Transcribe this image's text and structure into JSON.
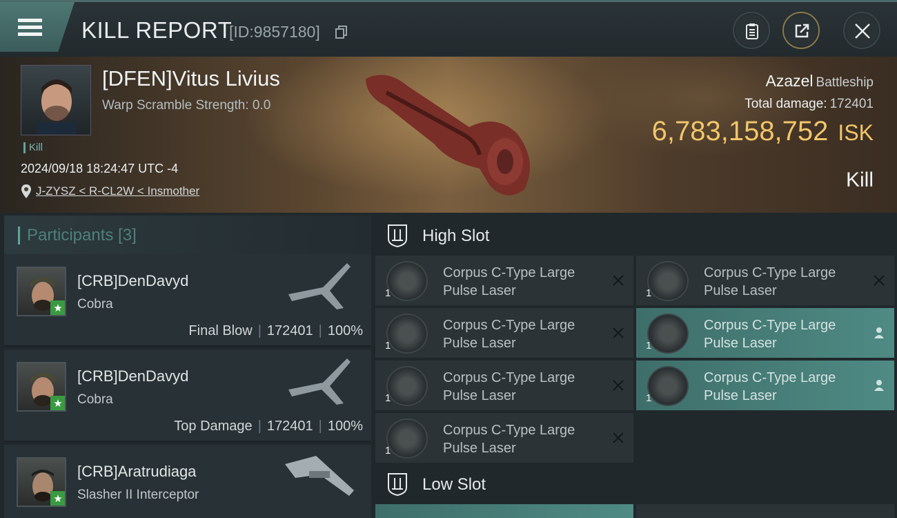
{
  "header": {
    "title": "KILL REPORT",
    "report_id": "[ID:9857180]",
    "icons": {
      "menu": "menu-icon",
      "copy": "copy-icon",
      "clipboard": "clipboard-icon",
      "share": "share-icon",
      "close": "close-icon"
    }
  },
  "victim": {
    "name": "[DFEN]Vitus Livius",
    "warp_scramble": "Warp Scramble Strength: 0.0",
    "kill_tag": "Kill",
    "timestamp": "2024/09/18 18:24:47 UTC -4",
    "location": "J-ZYSZ < R-CL2W < Insmother",
    "ship_name": "Azazel",
    "ship_class": "Battleship",
    "total_damage_label": "Total damage:",
    "total_damage": "172401",
    "isk_value": "6,783,158,752",
    "isk_unit": "ISK",
    "result": "Kill"
  },
  "participants": {
    "title": "Participants [3]",
    "rows": [
      {
        "name": "[CRB]DenDavyd",
        "ship": "Cobra",
        "role": "Final Blow",
        "damage": "172401",
        "percent": "100%"
      },
      {
        "name": "[CRB]DenDavyd",
        "ship": "Cobra",
        "role": "Top Damage",
        "damage": "172401",
        "percent": "100%"
      },
      {
        "name": "[CRB]Aratrudiaga",
        "ship": "Slasher II Interceptor",
        "role": "",
        "damage": "",
        "percent": ""
      }
    ]
  },
  "fitting": {
    "high_slot_title": "High Slot",
    "low_slot_title": "Low Slot",
    "high_modules": [
      {
        "name": "Corpus C-Type Large Pulse Laser",
        "qty": "1",
        "state": "destroyed"
      },
      {
        "name": "Corpus C-Type Large Pulse Laser",
        "qty": "1",
        "state": "destroyed"
      },
      {
        "name": "Corpus C-Type Large Pulse Laser",
        "qty": "1",
        "state": "destroyed"
      },
      {
        "name": "Corpus C-Type Large Pulse Laser",
        "qty": "1",
        "state": "dropped"
      },
      {
        "name": "Corpus C-Type Large Pulse Laser",
        "qty": "1",
        "state": "dropped"
      },
      {
        "name": "Corpus C-Type Large Pulse Laser",
        "qty": "1",
        "state": "destroyed"
      },
      {
        "name": "Corpus C-Type Large Pulse Laser",
        "qty": "1",
        "state": "destroyed"
      }
    ]
  },
  "colors": {
    "accent_teal": "#5fa59b",
    "isk_gold": "#f1c56a",
    "background": "#1b2226"
  }
}
